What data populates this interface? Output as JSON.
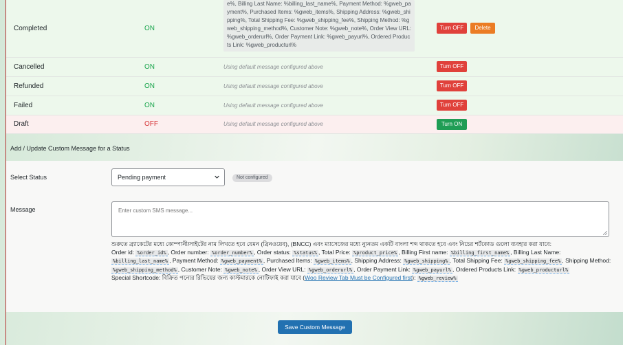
{
  "statuses": [
    {
      "name": "Completed",
      "state": "ON",
      "state_class": "on",
      "action": "Turn OFF",
      "delete": "Delete",
      "message": "e%, Billing Last Name: %billing_last_name%, Payment Method: %gweb_payment%, Purchased Items: %gweb_items%, Shipping Address: %gweb_shipping%, Total Shipping Fee: %gweb_shipping_fee%, Shipping Method: %gweb_shipping_method%, Customer Note: %gweb_note%, Order View URL: %gweb_orderurl%, Order Payment Link: %gweb_payurl%, Ordered Products Link: %gweb_producturl%"
    },
    {
      "name": "Cancelled",
      "state": "ON",
      "state_class": "on",
      "action": "Turn OFF",
      "message": "Using default message configured above"
    },
    {
      "name": "Refunded",
      "state": "ON",
      "state_class": "on",
      "action": "Turn OFF",
      "message": "Using default message configured above"
    },
    {
      "name": "Failed",
      "state": "ON",
      "state_class": "on",
      "action": "Turn OFF",
      "message": "Using default message configured above"
    },
    {
      "name": "Draft",
      "state": "OFF",
      "state_class": "off",
      "action": "Turn ON",
      "message": "Using default message configured above"
    }
  ],
  "form": {
    "section_title": "Add / Update Custom Message for a Status",
    "select_label": "Select Status",
    "select_value": "Pending payment",
    "status_badge": "Not configured",
    "message_label": "Message",
    "message_placeholder": "Enter custom SMS message...",
    "instruction": "শুরুতে ব্র্যাকেটের মধ্যে কোম্পানী/সাইটের নাম লিখতে হবে যেমন (ব্রিনওয়েব), (BNCC) এবং ম্যাসেজের মধ্যে ন্যুনতম একটি বাংলা শব্দ থাকতে হবে এবং নিচের শর্টকোড গুলো ব্যবহার করা যাবে:",
    "shortcodes": [
      {
        "label": "Order id:",
        "code": "%order_id%"
      },
      {
        "label": "Order number:",
        "code": "%order_number%"
      },
      {
        "label": "Order status:",
        "code": "%status%"
      },
      {
        "label": "Total Price:",
        "code": "%product_price%"
      },
      {
        "label": "Billing First name:",
        "code": "%billing_first_name%"
      },
      {
        "label": "Billing Last Name:",
        "code": "%billing_last_name%"
      },
      {
        "label": "Payment Method:",
        "code": "%gweb_payment%"
      },
      {
        "label": "Purchased Items:",
        "code": "%gweb_items%"
      },
      {
        "label": "Shipping Address:",
        "code": "%gweb_shipping%"
      },
      {
        "label": "Total Shipping Fee:",
        "code": "%gweb_shipping_fee%"
      },
      {
        "label": "Shipping Method:",
        "code": "%gweb_shipping_method%"
      },
      {
        "label": "Customer Note:",
        "code": "%gweb_note%"
      },
      {
        "label": "Order View URL:",
        "code": "%gweb_orderurl%"
      },
      {
        "label": "Order Payment Link:",
        "code": "%gweb_payurl%"
      },
      {
        "label": "Ordered Products Link:",
        "code": "%gweb_producturl%"
      }
    ],
    "special_label": "Special Shortcode:",
    "special_text": "বিক্রিত পন্যের রিভিয়ের জন্য কাস্টমারকে নোটিফাই করা যাবে (",
    "special_link": "Woo Review Tab Must be Configured first",
    "special_close": "):",
    "special_code": "%gweb_review%",
    "save_label": "Save Custom Message"
  },
  "colors": {
    "turn_off": "#e0413b",
    "turn_on": "#1f9d55",
    "delete": "#eb7c24",
    "primary": "#2271b1"
  }
}
